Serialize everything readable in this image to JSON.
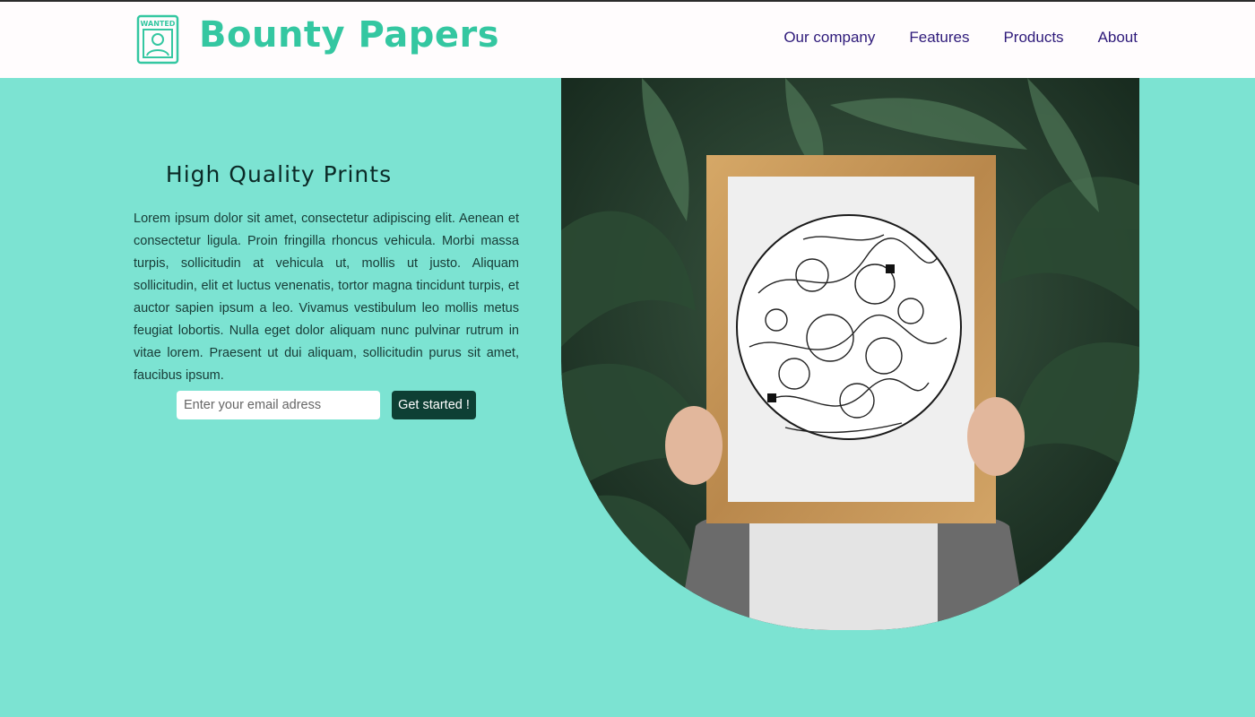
{
  "brand": {
    "name": "Bounty Papers",
    "logo_text": "WANTED",
    "color": "#34c7a1"
  },
  "nav": {
    "items": [
      {
        "label": "Our company"
      },
      {
        "label": "Features"
      },
      {
        "label": "Products"
      },
      {
        "label": "About"
      }
    ],
    "color": "#2e1a7a"
  },
  "hero": {
    "title": "High Quality Prints",
    "body": "Lorem ipsum dolor sit amet, consectetur adipiscing elit. Aenean et consectetur ligula. Proin fringilla rhoncus vehicula. Morbi massa turpis, sollicitudin at vehicula ut, mollis ut justo. Aliquam sollicitudin, elit et luctus venenatis, tortor magna tincidunt turpis, et auctor sapien ipsum a leo. Vivamus vestibulum leo mollis metus feugiat lobortis. Nulla eget dolor aliquam nunc pulvinar rutrum in vitae lorem. Praesent ut dui aliquam, sollicitudin purus sit amet, faucibus ipsum.",
    "email_placeholder": "Enter your email adress",
    "cta_label": "Get started !",
    "background_color": "#7ce3d2",
    "button_color": "#0e3f34"
  },
  "image": {
    "icon": "framed-doodle-art-photo"
  }
}
